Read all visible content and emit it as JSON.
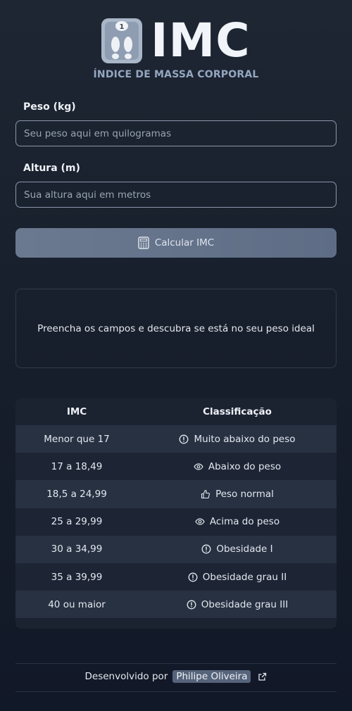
{
  "header": {
    "title": "IMC",
    "subtitle": "ÍNDICE DE MASSA CORPORAL",
    "logo_badge": "1"
  },
  "form": {
    "weight": {
      "label": "Peso (kg)",
      "placeholder": "Seu peso aqui em quilogramas",
      "value": ""
    },
    "height": {
      "label": "Altura (m)",
      "placeholder": "Sua altura aqui em metros",
      "value": ""
    },
    "submit_label": "Calcular IMC"
  },
  "result": {
    "message": "Preencha os campos e descubra se está no seu peso ideal"
  },
  "table": {
    "headers": {
      "imc": "IMC",
      "classification": "Classificação"
    },
    "rows": [
      {
        "range": "Menor que 17",
        "label": "Muito abaixo do peso",
        "icon": "alert-circle-icon"
      },
      {
        "range": "17 a 18,49",
        "label": "Abaixo do peso",
        "icon": "eye-icon"
      },
      {
        "range": "18,5 a 24,99",
        "label": "Peso normal",
        "icon": "thumbs-up-icon"
      },
      {
        "range": "25 a 29,99",
        "label": "Acima do peso",
        "icon": "eye-icon"
      },
      {
        "range": "30 a 34,99",
        "label": "Obesidade I",
        "icon": "alert-circle-icon"
      },
      {
        "range": "35 a 39,99",
        "label": "Obesidade grau II",
        "icon": "alert-circle-icon"
      },
      {
        "range": "40 ou maior",
        "label": "Obesidade grau III",
        "icon": "alert-circle-icon"
      }
    ]
  },
  "footer": {
    "prefix": "Desenvolvido por",
    "author": "Philipe Oliveira"
  },
  "colors": {
    "background": "#1e2633",
    "button": "#64738a",
    "row_odd": "#273142",
    "row_even": "#1d2535",
    "accent_text": "#94a6c0"
  }
}
